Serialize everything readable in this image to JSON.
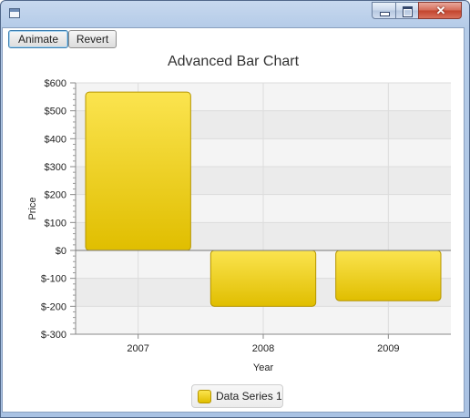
{
  "window": {
    "close_glyph": "✕",
    "icons": [
      "app-icon",
      "minimize-icon",
      "maximize-icon",
      "close-icon"
    ]
  },
  "toolbar": {
    "animate_label": "Animate",
    "revert_label": "Revert"
  },
  "chart_data": {
    "type": "bar",
    "title": "Advanced Bar Chart",
    "xlabel": "Year",
    "ylabel": "Price",
    "categories": [
      "2007",
      "2008",
      "2009"
    ],
    "series": [
      {
        "name": "Data Series 1",
        "values": [
          567,
          -200,
          -180
        ]
      }
    ],
    "ylim": [
      -300,
      600
    ],
    "yticks": [
      600,
      500,
      400,
      300,
      200,
      100,
      0,
      -100,
      -200,
      -300
    ],
    "ytick_labels": [
      "$600",
      "$500",
      "$400",
      "$300",
      "$200",
      "$100",
      "$0",
      "$-100",
      "$-200",
      "$-300"
    ],
    "grid": true,
    "legend_position": "bottom",
    "colors": {
      "bar_top": "#fbe44f",
      "bar_bottom": "#e0be00",
      "bar_border": "#b59500"
    }
  }
}
